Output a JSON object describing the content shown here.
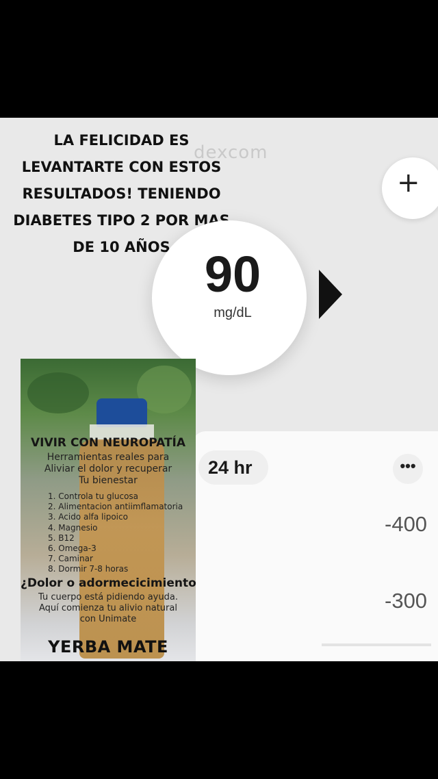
{
  "brand": {
    "name": "Dexcom"
  },
  "caption": {
    "lines": [
      "LA FELICIDAD ES",
      "LEVANTARTE CON ESTOS",
      "RESULTADOS! TENIENDO",
      "DIABETES TIPO 2 POR MAS",
      "DE 10 AÑOS"
    ]
  },
  "glucose": {
    "value": "90",
    "unit": "mg/dL",
    "trend": "steady"
  },
  "controls": {
    "add_label": "+",
    "range_label": "24 hr",
    "more_label": "•••"
  },
  "chart": {
    "y_ticks": [
      "400",
      "300"
    ]
  },
  "ad": {
    "title": "VIVIR CON NEUROPATÍA",
    "subtitle_lines": [
      "Herramientas reales para",
      "Aliviar el dolor y recuperar",
      "Tu bienestar"
    ],
    "list_items": [
      "1. Controla tu glucosa",
      "2. Alimentacion antiimflamatoria",
      "3. Acido alfa lipoico",
      "4. Magnesio",
      "5. B12",
      "6. Omega-3",
      "7. Caminar",
      "8. Dormir 7-8 horas"
    ],
    "question": "¿Dolor o adormecicimiento?",
    "para_lines": [
      "Tu cuerpo está pidiendo ayuda.",
      "Aquí comienza tu alivio natural",
      "con Unimate"
    ],
    "brand": "YERBA MATE"
  },
  "colors": {
    "screen_bg": "#e9e9e9",
    "bottle_cap": "#1d4d9a",
    "text_dark": "#111111"
  }
}
